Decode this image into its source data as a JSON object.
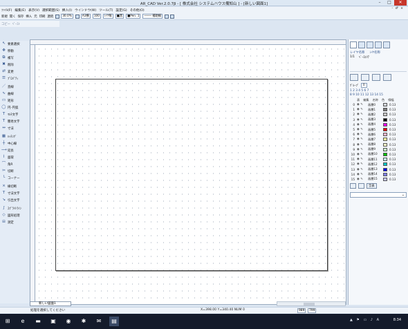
{
  "window": {
    "title": "AR_CAD Ver.2.0.7β - [ 株式会社 システムハウス備知山 ] - [新しい図面1]",
    "controls": [
      "–",
      "□",
      "✕"
    ]
  },
  "menubar": {
    "items": [
      "ﾌｧｲﾙ(F)",
      "編集(E)",
      "表示(V)",
      "選択範囲(S)",
      "挿入(I)",
      "ウインドウ(W)",
      "ツール(T)",
      "設定(G)",
      "その他(O)"
    ],
    "mdi": "- ♂ ×"
  },
  "toolbar": {
    "items": [
      "新規",
      "開く",
      "保存",
      "挿入",
      "元",
      "印刷",
      "連続"
    ],
    "zoom_value": "30.0%",
    "paper_size": "A3横",
    "scale_value": "100",
    "line_type_value": "ﾚｲﾔ毎",
    "color_value": "■黒",
    "pen_value": "■Pen. 1",
    "line_style_value": "──── 補助線"
  },
  "toolbar2": {
    "items": [
      "コピー",
      "ﾍﾟｰｽﾄ"
    ]
  },
  "left_tools": [
    {
      "icon": "pointer-icon",
      "label": "要素選択"
    },
    {
      "icon": "move-icon",
      "label": "移動"
    },
    {
      "icon": "copy-icon",
      "label": "複写"
    },
    {
      "icon": "delete-icon",
      "label": "削除"
    },
    {
      "icon": "change-icon",
      "label": "変更"
    },
    {
      "icon": "property-icon",
      "label": "ﾌﾟﾛﾊﾟﾃｨ"
    },
    {
      "icon": "line-icon",
      "label": "直線"
    },
    {
      "icon": "curve-icon",
      "label": "曲線"
    },
    {
      "icon": "rect-icon",
      "label": "矩形"
    },
    {
      "icon": "circle-icon",
      "label": "円･円弧"
    },
    {
      "icon": "text-icon",
      "label": "ﾏﾙﾁ文字"
    },
    {
      "icon": "text-icon",
      "label": "簡易文字"
    },
    {
      "icon": "dimension-icon",
      "label": "寸法"
    },
    {
      "icon": "hatch-icon",
      "label": "ﾊｯﾁﾝｸﾞ"
    },
    {
      "icon": "center-line-icon",
      "label": "中心線"
    },
    {
      "icon": "extend-icon",
      "label": "延長"
    },
    {
      "icon": "offset-icon",
      "label": "面取"
    },
    {
      "icon": "fillet-icon",
      "label": "角R"
    },
    {
      "icon": "trim-icon",
      "label": "切断"
    },
    {
      "icon": "corner-icon",
      "label": "コーナー"
    },
    {
      "icon": "connect-icon",
      "label": "線切断"
    },
    {
      "icon": "dim-text-icon",
      "label": "寸法文字"
    },
    {
      "icon": "leader-icon",
      "label": "引出文字"
    },
    {
      "icon": "sprite-icon",
      "label": "ｽﾌﾟﾗｲﾄﾗｲﾝ"
    },
    {
      "icon": "shape-icon",
      "label": "図形処理"
    },
    {
      "icon": "measure-icon",
      "label": "測定"
    }
  ],
  "right_panel": {
    "layer_group_label": "レイヤ名称",
    "layer_group_header": "ﾚｲﾔ名称",
    "page_label": "1/1",
    "base_area_label": "ﾍﾞｰｽｴﾘｱ",
    "group_label": "ｸﾞﾙｰﾌﾟ",
    "group_value": "0",
    "numbers_row1": "1 2 3 4 5 6 7",
    "numbers_row2": "8 9 10 11 12 13 14 15",
    "layer_headers": [
      "表",
      "編集",
      "名称",
      "色",
      "線幅"
    ],
    "layers": [
      {
        "n": "0",
        "name": "画層0",
        "color": "#d4d8dc",
        "w": "0.13"
      },
      {
        "n": "1",
        "name": "画層1",
        "color": "#7a7a7a",
        "w": "0.13"
      },
      {
        "n": "2",
        "name": "画層2",
        "color": "#c8c8c8",
        "w": "0.13"
      },
      {
        "n": "3",
        "name": "画層3",
        "color": "#000000",
        "w": "0.13"
      },
      {
        "n": "4",
        "name": "画層4",
        "color": "#ff00ff",
        "w": "0.13"
      },
      {
        "n": "5",
        "name": "画層5",
        "color": "#ff0000",
        "w": "0.13"
      },
      {
        "n": "6",
        "name": "画層6",
        "color": "#ffb8d0",
        "w": "0.13"
      },
      {
        "n": "7",
        "name": "画層7",
        "color": "#ffffa0",
        "w": "0.13"
      },
      {
        "n": "8",
        "name": "画層8",
        "color": "#ffffc8",
        "w": "0.13"
      },
      {
        "n": "9",
        "name": "画層9",
        "color": "#c8ffc8",
        "w": "0.13"
      },
      {
        "n": "10",
        "name": "画層10",
        "color": "#00c000",
        "w": "0.13"
      },
      {
        "n": "11",
        "name": "画層11",
        "color": "#c8ffff",
        "w": "0.13"
      },
      {
        "n": "12",
        "name": "画層12",
        "color": "#00c8c8",
        "w": "0.13"
      },
      {
        "n": "13",
        "name": "画層13",
        "color": "#0000ff",
        "w": "0.13"
      },
      {
        "n": "14",
        "name": "画層14",
        "color": "#8080ff",
        "w": "0.13"
      },
      {
        "n": "15",
        "name": "画層15",
        "color": "#c8c8ff",
        "w": "0.13"
      }
    ],
    "bottom_btn": "全表"
  },
  "tab": {
    "label": "新しい図面1"
  },
  "status": {
    "message": "処理を選択してください",
    "coords": "X=398.00  Y=340.40  NUM 0",
    "box1": "989",
    "box2": "799"
  },
  "taskbar": {
    "clock": "8:34",
    "tray": "▲ ⚑ ▭ ♪ A"
  }
}
